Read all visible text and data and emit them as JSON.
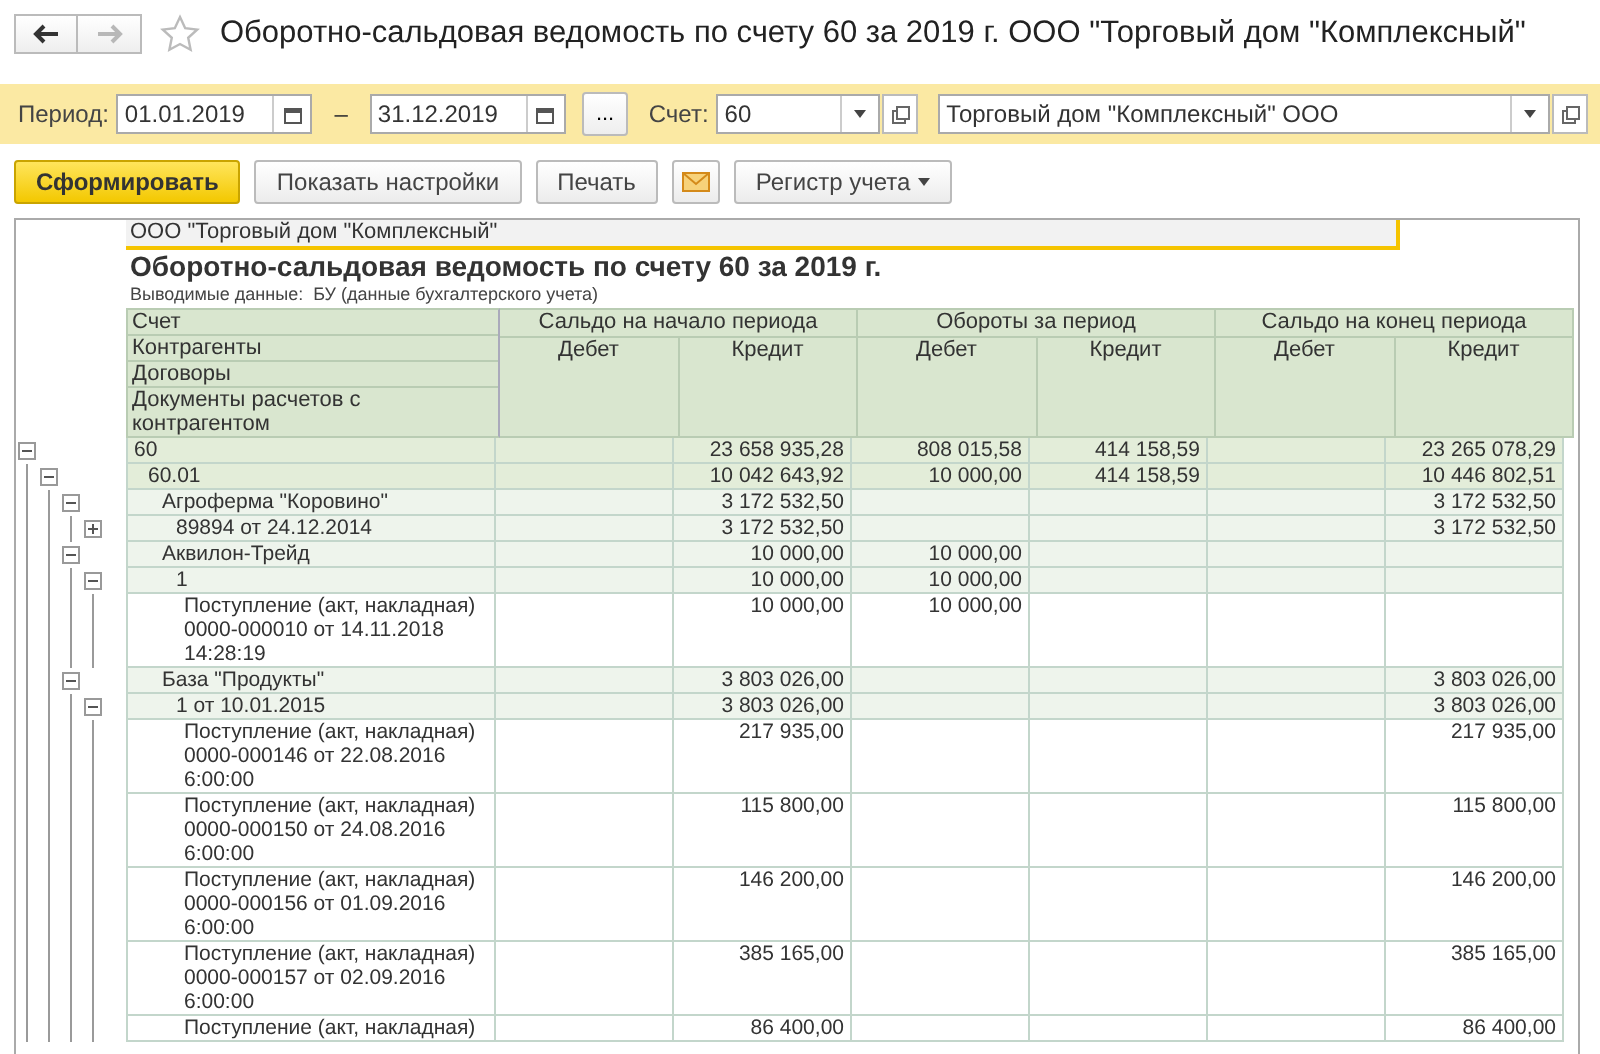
{
  "window": {
    "title": "Оборотно-сальдовая ведомость по счету 60 за 2019 г. ООО \"Торговый дом \"Комплексный\"",
    "favorite": false
  },
  "nav": [
    {
      "kind": "back",
      "disabled": false
    },
    {
      "kind": "forward",
      "disabled": true
    }
  ],
  "filter": {
    "period_label": "Период:",
    "date_from": "01.01.2019",
    "dash": "–",
    "date_to": "31.12.2019",
    "more": "...",
    "account_label": "Счет:",
    "account": "60",
    "counterparty": "Торговый дом \"Комплексный\" ООО"
  },
  "toolbar": [
    {
      "kind": "primary",
      "label": "Сформировать"
    },
    {
      "kind": "plain",
      "label": "Показать настройки"
    },
    {
      "kind": "plain",
      "label": "Печать"
    },
    {
      "kind": "mail"
    },
    {
      "kind": "menu",
      "label": "Регистр учета"
    }
  ],
  "report": {
    "company": "ООО \"Торговый дом \"Комплексный\"",
    "title": "Оборотно-сальдовая ведомость по счету 60 за 2019 г.",
    "output_label": "Выводимые данные:",
    "output_value": "БУ (данные бухгалтерского учета)"
  },
  "table": {
    "first_headers": [
      "Счет",
      "Контрагенты",
      "Договоры",
      "Документы расчетов с контрагентом"
    ],
    "groups": [
      {
        "title": "Сальдо на начало периода",
        "sub": [
          "Дебет",
          "Кредит"
        ]
      },
      {
        "title": "Обороты за период",
        "sub": [
          "Дебет",
          "Кредит"
        ]
      },
      {
        "title": "Сальдо на конец периода",
        "sub": [
          "Дебет",
          "Кредит"
        ]
      }
    ],
    "rows": [
      {
        "kind": "group",
        "label": "60",
        "expanded": true,
        "start_credit": "23 658 935,28",
        "turn_debit": "808 015,58",
        "turn_credit": "414 158,59",
        "end_credit": "23 265 078,29",
        "children": [
          {
            "kind": "group",
            "label": "60.01",
            "expanded": true,
            "start_credit": "10 042 643,92",
            "turn_debit": "10 000,00",
            "turn_credit": "414 158,59",
            "end_credit": "10 446 802,51",
            "children": [
              {
                "kind": "group",
                "label": "Агроферма \"Коровино\"",
                "expanded": true,
                "start_credit": "3 172 532,50",
                "end_credit": "3 172 532,50",
                "children": [
                  {
                    "kind": "group",
                    "label": "89894 от 24.12.2014",
                    "expanded": false,
                    "start_credit": "3 172 532,50",
                    "end_credit": "3 172 532,50"
                  }
                ]
              },
              {
                "kind": "group",
                "label": "Аквилон-Трейд",
                "expanded": true,
                "start_credit": "10 000,00",
                "turn_debit": "10 000,00",
                "children": [
                  {
                    "kind": "group",
                    "label": "1",
                    "expanded": true,
                    "start_credit": "10 000,00",
                    "turn_debit": "10 000,00",
                    "children": [
                      {
                        "kind": "document",
                        "label": "Поступление (акт, накладная)\n0000-000010 от 14.11.2018\n14:28:19",
                        "start_credit": "10 000,00",
                        "turn_debit": "10 000,00"
                      }
                    ]
                  }
                ]
              },
              {
                "kind": "group",
                "label": "База \"Продукты\"",
                "expanded": true,
                "start_credit": "3 803 026,00",
                "end_credit": "3 803 026,00",
                "children": [
                  {
                    "kind": "group",
                    "label": "1 от 10.01.2015",
                    "expanded": true,
                    "start_credit": "3 803 026,00",
                    "end_credit": "3 803 026,00",
                    "children": [
                      {
                        "kind": "document",
                        "label": "Поступление (акт, накладная)\n0000-000146 от 22.08.2016\n6:00:00",
                        "start_credit": "217 935,00",
                        "end_credit": "217 935,00"
                      },
                      {
                        "kind": "document",
                        "label": "Поступление (акт, накладная)\n0000-000150 от 24.08.2016\n6:00:00",
                        "start_credit": "115 800,00",
                        "end_credit": "115 800,00"
                      },
                      {
                        "kind": "document",
                        "label": "Поступление (акт, накладная)\n0000-000156 от 01.09.2016\n6:00:00",
                        "start_credit": "146 200,00",
                        "end_credit": "146 200,00"
                      },
                      {
                        "kind": "document",
                        "label": "Поступление (акт, накладная)\n0000-000157 от 02.09.2016\n6:00:00",
                        "start_credit": "385 165,00",
                        "end_credit": "385 165,00"
                      },
                      {
                        "kind": "document",
                        "label": "Поступление (акт, накладная)",
                        "start_credit": "86 400,00",
                        "end_credit": "86 400,00"
                      }
                    ]
                  }
                ]
              }
            ]
          }
        ]
      }
    ]
  }
}
